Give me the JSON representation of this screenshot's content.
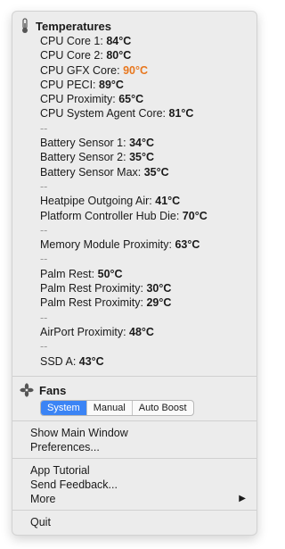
{
  "temperatures": {
    "title": "Temperatures",
    "icon": "thermometer-icon",
    "rows": [
      {
        "label": "CPU Core 1:",
        "value": "84°C"
      },
      {
        "label": "CPU Core 2:",
        "value": "80°C"
      },
      {
        "label": "CPU GFX Core:",
        "value": "90°C",
        "hot": true
      },
      {
        "label": "CPU PECI:",
        "value": "89°C"
      },
      {
        "label": "CPU Proximity:",
        "value": "65°C"
      },
      {
        "label": "CPU System Agent Core:",
        "value": "81°C"
      },
      {
        "separator": "--"
      },
      {
        "label": "Battery Sensor 1:",
        "value": "34°C"
      },
      {
        "label": "Battery Sensor 2:",
        "value": "35°C"
      },
      {
        "label": "Battery Sensor Max:",
        "value": "35°C"
      },
      {
        "separator": "--"
      },
      {
        "label": "Heatpipe Outgoing Air:",
        "value": "41°C"
      },
      {
        "label": "Platform Controller Hub Die:",
        "value": "70°C"
      },
      {
        "separator": "--"
      },
      {
        "label": "Memory Module Proximity:",
        "value": "63°C"
      },
      {
        "separator": "--"
      },
      {
        "label": "Palm Rest:",
        "value": "50°C"
      },
      {
        "label": "Palm Rest Proximity:",
        "value": "30°C"
      },
      {
        "label": "Palm Rest Proximity:",
        "value": "29°C"
      },
      {
        "separator": "--"
      },
      {
        "label": "AirPort Proximity:",
        "value": "48°C"
      },
      {
        "separator": "--"
      },
      {
        "label": "SSD A:",
        "value": "43°C"
      }
    ]
  },
  "fans": {
    "title": "Fans",
    "icon": "fan-icon",
    "modes": [
      "System",
      "Manual",
      "Auto Boost"
    ],
    "selected": "System"
  },
  "menu": {
    "show_main_window": "Show Main Window",
    "preferences": "Preferences...",
    "app_tutorial": "App Tutorial",
    "send_feedback": "Send Feedback...",
    "more": "More",
    "more_arrow": "▶",
    "quit": "Quit"
  },
  "colors": {
    "hot": "#e8771e",
    "accent": "#3b84f5"
  }
}
